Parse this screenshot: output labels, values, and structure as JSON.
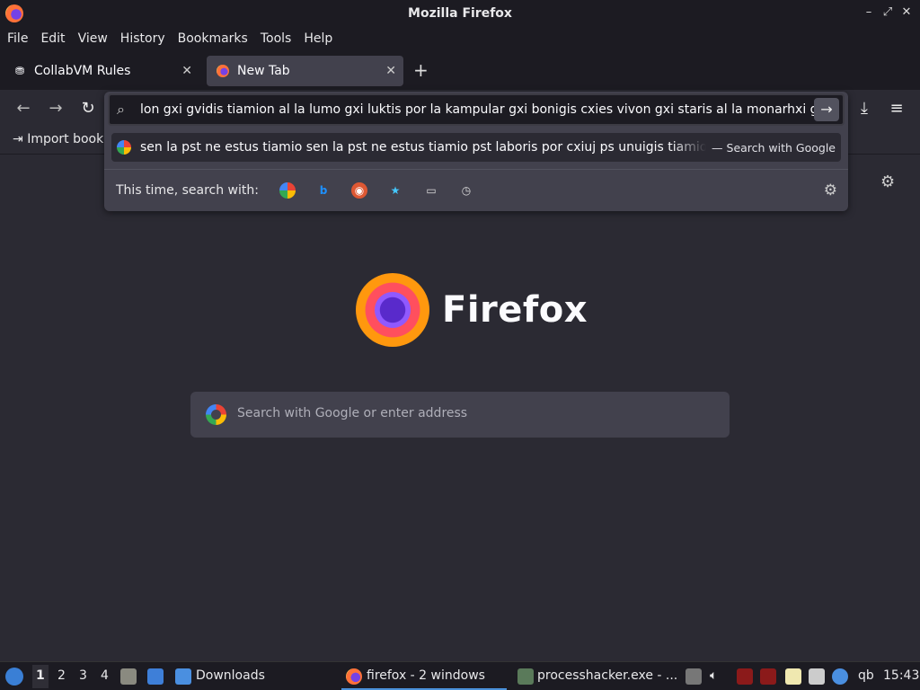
{
  "window": {
    "title": "Mozilla Firefox"
  },
  "menu": [
    "File",
    "Edit",
    "View",
    "History",
    "Bookmarks",
    "Tools",
    "Help"
  ],
  "tabs": [
    {
      "label": "CollabVM Rules",
      "active": false
    },
    {
      "label": "New Tab",
      "active": true
    }
  ],
  "bookmarks": {
    "import_label": "Import book"
  },
  "urlbar": {
    "value": "lon gxi gvidis tiamion al la lumo gxi luktis por la kampular gxi bonigis cxies vivon gxi staris al la monarhxi g",
    "suggestion": "sen la pst ne estus tiamio sen la pst ne estus tiamio pst laboris por cxiuj ps unuigis tiamio",
    "suggestion_hint": "— Search with Google",
    "oneoff_label": "This time, search with:"
  },
  "newtab": {
    "brand": "Firefox",
    "search_placeholder": "Search with Google or enter address"
  },
  "taskbar": {
    "workspaces": [
      "1",
      "2",
      "3",
      "4"
    ],
    "downloads": "Downloads",
    "firefox": "firefox - 2 windows",
    "processhacker": "processhacker.exe - ...",
    "qb": "qb",
    "clock": "15:43"
  },
  "colors": {
    "accent": "#4a90d9",
    "toolbar": "#2b2a33",
    "frame": "#1c1b22",
    "panel": "#42414d"
  }
}
